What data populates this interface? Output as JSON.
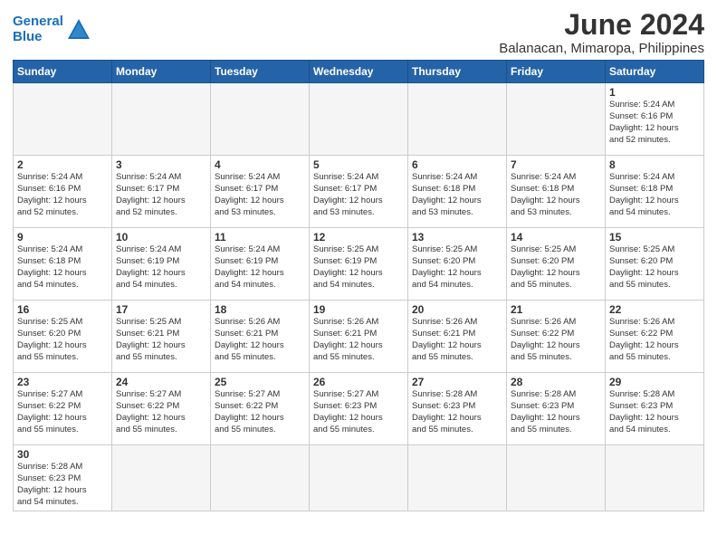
{
  "header": {
    "logo_general": "General",
    "logo_blue": "Blue",
    "month": "June 2024",
    "location": "Balanacan, Mimaropa, Philippines"
  },
  "days_of_week": [
    "Sunday",
    "Monday",
    "Tuesday",
    "Wednesday",
    "Thursday",
    "Friday",
    "Saturday"
  ],
  "weeks": [
    [
      {
        "day": "",
        "info": ""
      },
      {
        "day": "",
        "info": ""
      },
      {
        "day": "",
        "info": ""
      },
      {
        "day": "",
        "info": ""
      },
      {
        "day": "",
        "info": ""
      },
      {
        "day": "",
        "info": ""
      },
      {
        "day": "1",
        "info": "Sunrise: 5:24 AM\nSunset: 6:16 PM\nDaylight: 12 hours\nand 52 minutes."
      }
    ],
    [
      {
        "day": "2",
        "info": "Sunrise: 5:24 AM\nSunset: 6:16 PM\nDaylight: 12 hours\nand 52 minutes."
      },
      {
        "day": "3",
        "info": "Sunrise: 5:24 AM\nSunset: 6:17 PM\nDaylight: 12 hours\nand 52 minutes."
      },
      {
        "day": "4",
        "info": "Sunrise: 5:24 AM\nSunset: 6:17 PM\nDaylight: 12 hours\nand 53 minutes."
      },
      {
        "day": "5",
        "info": "Sunrise: 5:24 AM\nSunset: 6:17 PM\nDaylight: 12 hours\nand 53 minutes."
      },
      {
        "day": "6",
        "info": "Sunrise: 5:24 AM\nSunset: 6:18 PM\nDaylight: 12 hours\nand 53 minutes."
      },
      {
        "day": "7",
        "info": "Sunrise: 5:24 AM\nSunset: 6:18 PM\nDaylight: 12 hours\nand 53 minutes."
      },
      {
        "day": "8",
        "info": "Sunrise: 5:24 AM\nSunset: 6:18 PM\nDaylight: 12 hours\nand 54 minutes."
      }
    ],
    [
      {
        "day": "9",
        "info": "Sunrise: 5:24 AM\nSunset: 6:18 PM\nDaylight: 12 hours\nand 54 minutes."
      },
      {
        "day": "10",
        "info": "Sunrise: 5:24 AM\nSunset: 6:19 PM\nDaylight: 12 hours\nand 54 minutes."
      },
      {
        "day": "11",
        "info": "Sunrise: 5:24 AM\nSunset: 6:19 PM\nDaylight: 12 hours\nand 54 minutes."
      },
      {
        "day": "12",
        "info": "Sunrise: 5:25 AM\nSunset: 6:19 PM\nDaylight: 12 hours\nand 54 minutes."
      },
      {
        "day": "13",
        "info": "Sunrise: 5:25 AM\nSunset: 6:20 PM\nDaylight: 12 hours\nand 54 minutes."
      },
      {
        "day": "14",
        "info": "Sunrise: 5:25 AM\nSunset: 6:20 PM\nDaylight: 12 hours\nand 55 minutes."
      },
      {
        "day": "15",
        "info": "Sunrise: 5:25 AM\nSunset: 6:20 PM\nDaylight: 12 hours\nand 55 minutes."
      }
    ],
    [
      {
        "day": "16",
        "info": "Sunrise: 5:25 AM\nSunset: 6:20 PM\nDaylight: 12 hours\nand 55 minutes."
      },
      {
        "day": "17",
        "info": "Sunrise: 5:25 AM\nSunset: 6:21 PM\nDaylight: 12 hours\nand 55 minutes."
      },
      {
        "day": "18",
        "info": "Sunrise: 5:26 AM\nSunset: 6:21 PM\nDaylight: 12 hours\nand 55 minutes."
      },
      {
        "day": "19",
        "info": "Sunrise: 5:26 AM\nSunset: 6:21 PM\nDaylight: 12 hours\nand 55 minutes."
      },
      {
        "day": "20",
        "info": "Sunrise: 5:26 AM\nSunset: 6:21 PM\nDaylight: 12 hours\nand 55 minutes."
      },
      {
        "day": "21",
        "info": "Sunrise: 5:26 AM\nSunset: 6:22 PM\nDaylight: 12 hours\nand 55 minutes."
      },
      {
        "day": "22",
        "info": "Sunrise: 5:26 AM\nSunset: 6:22 PM\nDaylight: 12 hours\nand 55 minutes."
      }
    ],
    [
      {
        "day": "23",
        "info": "Sunrise: 5:27 AM\nSunset: 6:22 PM\nDaylight: 12 hours\nand 55 minutes."
      },
      {
        "day": "24",
        "info": "Sunrise: 5:27 AM\nSunset: 6:22 PM\nDaylight: 12 hours\nand 55 minutes."
      },
      {
        "day": "25",
        "info": "Sunrise: 5:27 AM\nSunset: 6:22 PM\nDaylight: 12 hours\nand 55 minutes."
      },
      {
        "day": "26",
        "info": "Sunrise: 5:27 AM\nSunset: 6:23 PM\nDaylight: 12 hours\nand 55 minutes."
      },
      {
        "day": "27",
        "info": "Sunrise: 5:28 AM\nSunset: 6:23 PM\nDaylight: 12 hours\nand 55 minutes."
      },
      {
        "day": "28",
        "info": "Sunrise: 5:28 AM\nSunset: 6:23 PM\nDaylight: 12 hours\nand 55 minutes."
      },
      {
        "day": "29",
        "info": "Sunrise: 5:28 AM\nSunset: 6:23 PM\nDaylight: 12 hours\nand 54 minutes."
      }
    ],
    [
      {
        "day": "30",
        "info": "Sunrise: 5:28 AM\nSunset: 6:23 PM\nDaylight: 12 hours\nand 54 minutes."
      },
      {
        "day": "",
        "info": ""
      },
      {
        "day": "",
        "info": ""
      },
      {
        "day": "",
        "info": ""
      },
      {
        "day": "",
        "info": ""
      },
      {
        "day": "",
        "info": ""
      },
      {
        "day": "",
        "info": ""
      }
    ]
  ]
}
